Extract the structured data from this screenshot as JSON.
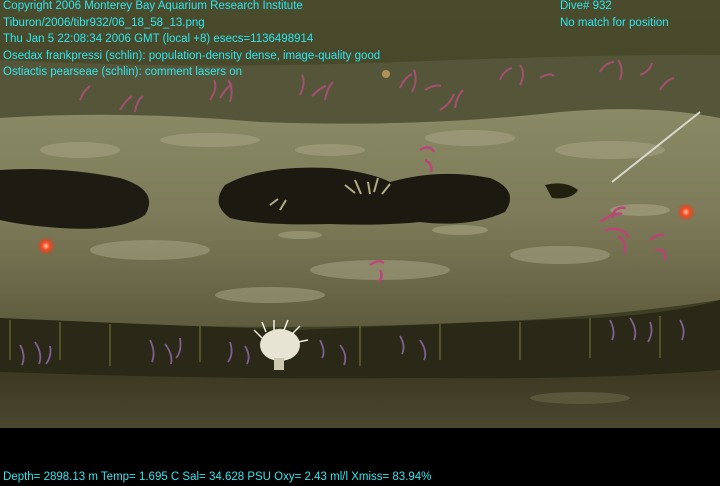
{
  "overlay": {
    "left_lines": [
      "Copyright 2006 Monterey Bay Aquarium Research Institute",
      "Tiburon/2006/tibr932/06_18_58_13.png",
      "Thu Jan  5 22:08:34 2006 GMT (local +8)  esecs=1136498914",
      "Osedax frankpressi (schlin): population-density dense, image-quality good",
      "Ostiactis pearseae (schlin): comment lasers on"
    ],
    "right_lines": [
      "Dive# 932",
      "No match for position"
    ],
    "bottom_line": "Depth= 2898.13 m  Temp= 1.695 C  Sal= 34.628 PSU  Oxy= 2.43 ml/l  Xmiss= 83.94%"
  },
  "colors": {
    "overlay_text": "#2ee6ee",
    "background": "#000000",
    "laser_dot": "#ff3a1a"
  },
  "scene": {
    "subject": "whale-bone with Osedax worms on seafloor",
    "icons": [
      "laser-dot-icon",
      "anemone-icon"
    ]
  }
}
